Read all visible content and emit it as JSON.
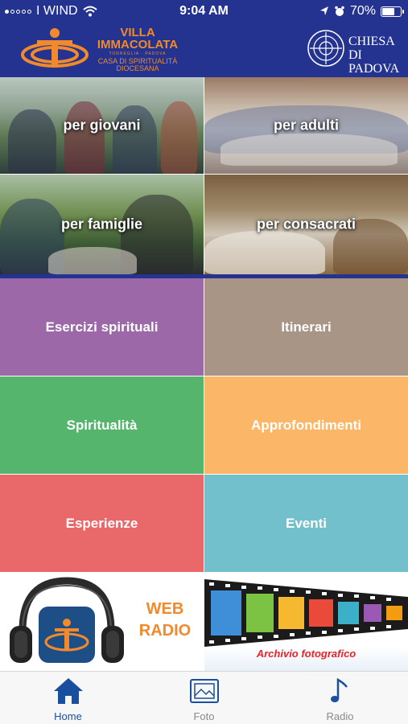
{
  "status_bar": {
    "carrier": "I WIND",
    "time": "9:04 AM",
    "battery": "70%",
    "battery_level": 0.7,
    "icons": [
      "wifi-icon",
      "location-icon",
      "alarm-icon",
      "battery-icon"
    ]
  },
  "header": {
    "logo_left": {
      "line1": "VILLA",
      "line2": "IMMACOLATA",
      "line3": "TORREGLIA · PADOVA",
      "line4": "CASA DI SPIRITUALITÀ",
      "line5": "DIOCESANA"
    },
    "logo_right": {
      "line1": "CHIESA DI",
      "line2": "PADOVA"
    },
    "colors": {
      "background": "#24338f",
      "accent": "#f08a2c"
    }
  },
  "audiences": [
    {
      "label": "per giovani"
    },
    {
      "label": "per adulti"
    },
    {
      "label": "per famiglie"
    },
    {
      "label": "per consacrati"
    }
  ],
  "tiles": [
    {
      "label": "Esercizi spirituali",
      "color": "#9c68a8"
    },
    {
      "label": "Itinerari",
      "color": "#a99585"
    },
    {
      "label": "Spiritualità",
      "color": "#55b56d"
    },
    {
      "label": "Approfondimenti",
      "color": "#fbb767"
    },
    {
      "label": "Esperienze",
      "color": "#e96869"
    },
    {
      "label": "Eventi",
      "color": "#72c0cc"
    }
  ],
  "banners": {
    "radio": {
      "line1": "WEB",
      "line2": "RADIO"
    },
    "foto": {
      "caption": "Archivio fotografico"
    }
  },
  "tabbar": {
    "items": [
      {
        "label": "Home",
        "icon": "home-icon",
        "active": true
      },
      {
        "label": "Foto",
        "icon": "photo-icon",
        "active": false
      },
      {
        "label": "Radio",
        "icon": "music-note-icon",
        "active": false
      }
    ]
  }
}
